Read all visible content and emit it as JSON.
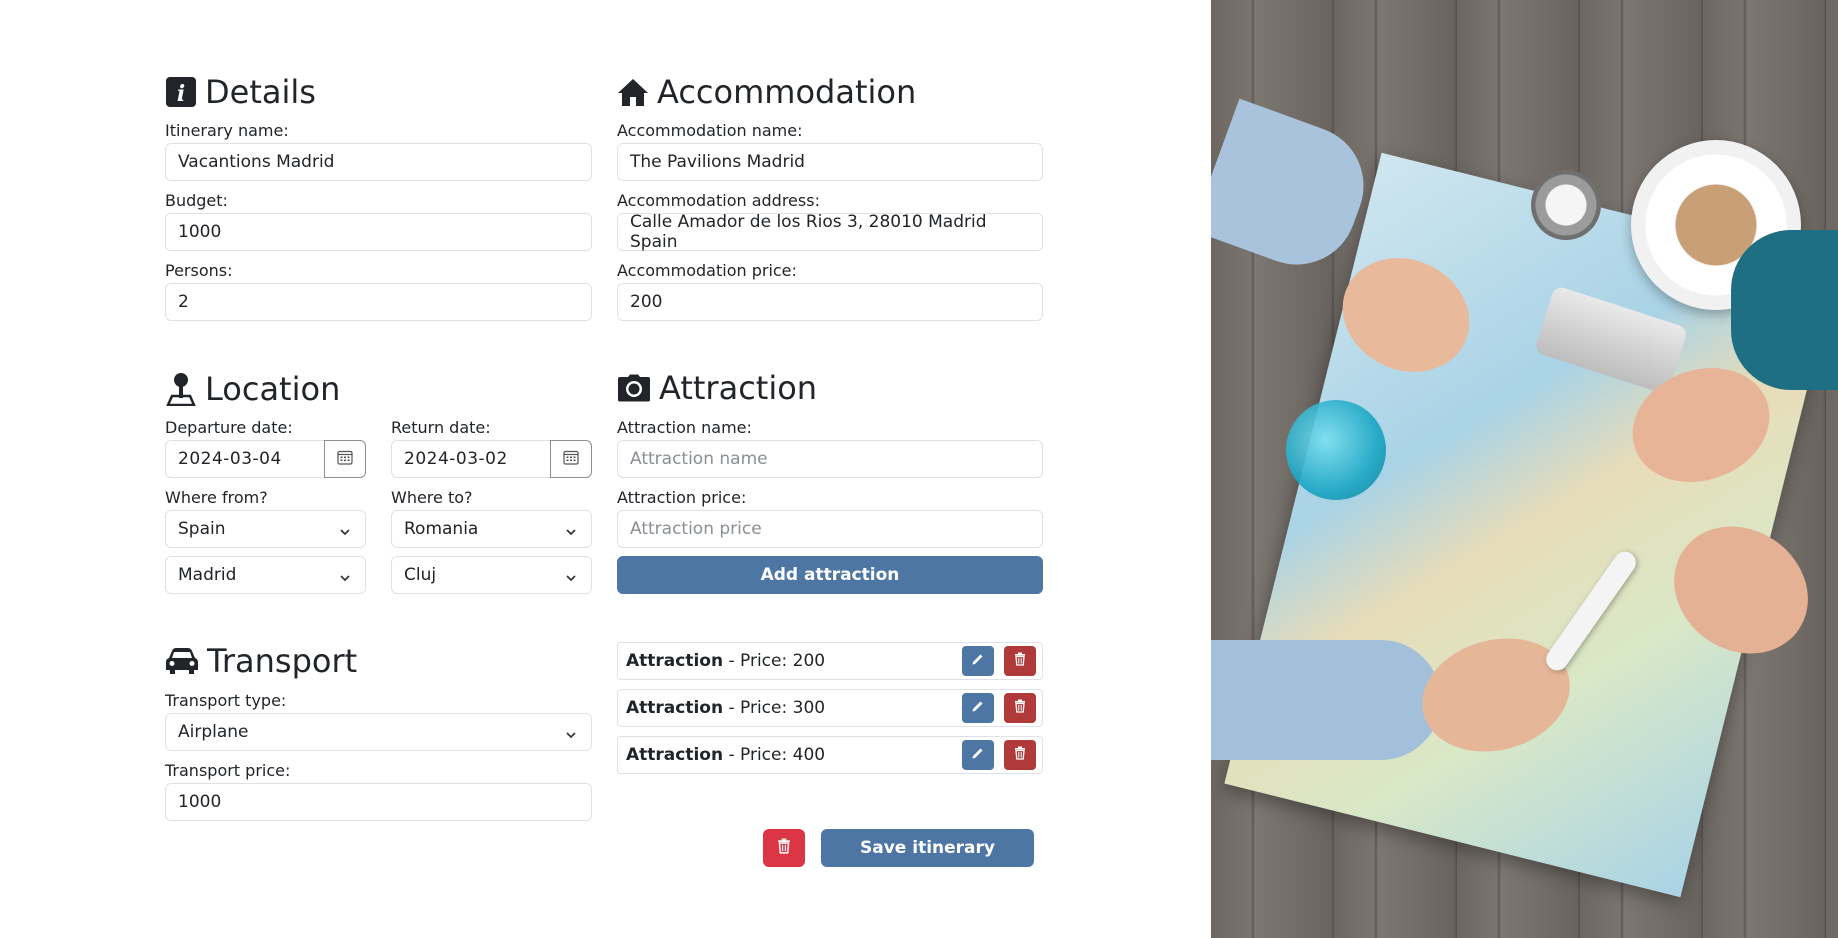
{
  "details": {
    "title": "Details",
    "itinerary_name_label": "Itinerary name:",
    "itinerary_name_value": "Vacantions Madrid",
    "budget_label": "Budget:",
    "budget_value": "1000",
    "persons_label": "Persons:",
    "persons_value": "2"
  },
  "accommodation": {
    "title": "Accommodation",
    "name_label": "Accommodation name:",
    "name_value": "The Pavilions Madrid",
    "address_label": "Accommodation address:",
    "address_value": "Calle Amador de los Rios 3, 28010 Madrid Spain",
    "price_label": "Accommodation price:",
    "price_value": "200"
  },
  "location": {
    "title": "Location",
    "departure_label": "Departure date:",
    "departure_value": "2024-03-04",
    "return_label": "Return date:",
    "return_value": "2024-03-02",
    "from_label": "Where from?",
    "from_country": "Spain",
    "from_city": "Madrid",
    "to_label": "Where to?",
    "to_country": "Romania",
    "to_city": "Cluj"
  },
  "attraction": {
    "title": "Attraction",
    "name_label": "Attraction name:",
    "name_placeholder": "Attraction name",
    "price_label": "Attraction price:",
    "price_placeholder": "Attraction price",
    "add_button": "Add attraction",
    "items": [
      {
        "name": "Attraction",
        "price_text": " - Price: 200"
      },
      {
        "name": "Attraction",
        "price_text": " - Price: 300"
      },
      {
        "name": "Attraction",
        "price_text": " - Price: 400"
      }
    ]
  },
  "transport": {
    "title": "Transport",
    "type_label": "Transport type:",
    "type_value": "Airplane",
    "price_label": "Transport price:",
    "price_value": "1000"
  },
  "actions": {
    "save_button": "Save itinerary"
  },
  "colors": {
    "primary": "#4d76a5",
    "danger": "#dc3545",
    "attraction_delete": "#b03a3a"
  },
  "icons": [
    "info-icon",
    "home-icon",
    "map-pin-icon",
    "camera-icon",
    "car-icon",
    "calendar-icon",
    "chevron-down-icon",
    "pencil-icon",
    "trash-icon"
  ]
}
